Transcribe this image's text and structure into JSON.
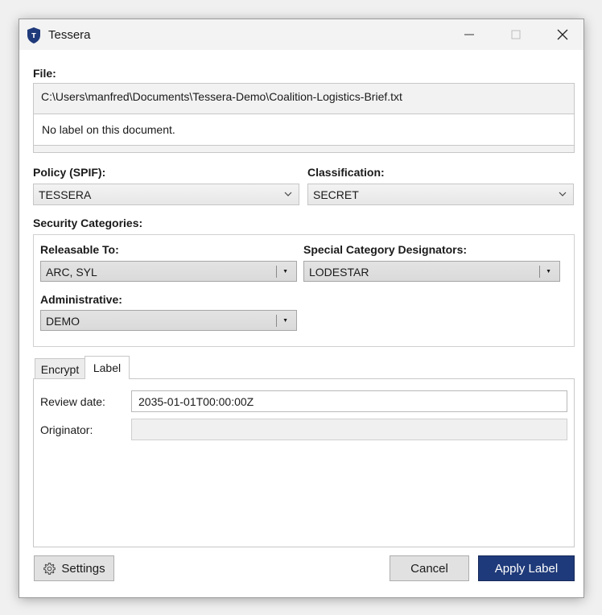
{
  "window": {
    "title": "Tessera",
    "icon": "shield-icon",
    "icon_letter": "T",
    "accent": "#1f3a7a"
  },
  "file": {
    "label": "File:",
    "path": "C:\\Users\\manfred\\Documents\\Tessera-Demo\\Coalition-Logistics-Brief.txt",
    "status": "No label on this document."
  },
  "policy": {
    "label": "Policy (SPIF):",
    "value": "TESSERA"
  },
  "classification": {
    "label": "Classification:",
    "value": "SECRET"
  },
  "security_categories": {
    "label": "Security Categories:",
    "releasable_to": {
      "label": "Releasable To:",
      "value": "ARC, SYL"
    },
    "special_category": {
      "label": "Special Category Designators:",
      "value": "LODESTAR"
    },
    "administrative": {
      "label": "Administrative:",
      "value": "DEMO"
    }
  },
  "tabs": [
    {
      "label": "Encrypt",
      "active": false
    },
    {
      "label": "Label",
      "active": true
    }
  ],
  "label_tab": {
    "review_date": {
      "label": "Review date:",
      "value": "2035-01-01T00:00:00Z"
    },
    "originator": {
      "label": "Originator:",
      "value": ""
    }
  },
  "buttons": {
    "settings": "Settings",
    "cancel": "Cancel",
    "apply": "Apply Label"
  }
}
